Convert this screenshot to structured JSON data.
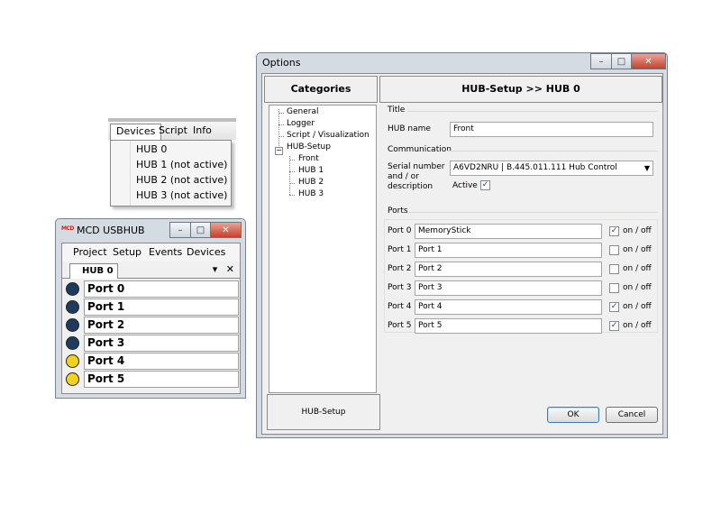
{
  "devices_menu": {
    "menubar": [
      "Devices",
      "Script",
      "Info"
    ],
    "items": [
      "HUB 0",
      "HUB 1 (not active)",
      "HUB 2 (not active)",
      "HUB 3 (not active)"
    ]
  },
  "usbhub_window": {
    "logo": "MCD",
    "title": "MCD USBHUB",
    "menu": [
      "Project",
      "Setup",
      "Events",
      "Devices"
    ],
    "tab": "HUB 0",
    "tab_tools": {
      "dropdown": "▾",
      "close": "✕"
    },
    "ports": [
      {
        "label": "Port 0",
        "state": "inactive"
      },
      {
        "label": "Port 1",
        "state": "inactive"
      },
      {
        "label": "Port 2",
        "state": "inactive"
      },
      {
        "label": "Port 3",
        "state": "inactive"
      },
      {
        "label": "Port 4",
        "state": "active"
      },
      {
        "label": "Port 5",
        "state": "active"
      }
    ]
  },
  "options_dialog": {
    "title": "Options",
    "categories_header": "Categories",
    "content_header": "HUB-Setup >> HUB 0",
    "tree": [
      "General",
      "Logger",
      "Script / Visualization",
      "HUB-Setup",
      "Front",
      "HUB 1",
      "HUB 2",
      "HUB 3"
    ],
    "tree_expander": "−",
    "bottom_label": "HUB-Setup",
    "title_group": {
      "label": "Title",
      "hub_name_label": "HUB name",
      "hub_name_value": "Front"
    },
    "communication_group": {
      "label": "Communication",
      "serial_label_lines": [
        "Serial number",
        "and / or",
        "description"
      ],
      "serial_value": "A6VD2NRU | B.445.011.111 Hub Control",
      "active_label": "Active",
      "active_checked": true
    },
    "ports_group": {
      "label": "Ports",
      "onoff_label": "on / off",
      "ports": [
        {
          "label": "Port 0",
          "name": "MemoryStick",
          "on": true
        },
        {
          "label": "Port 1",
          "name": "Port 1",
          "on": false
        },
        {
          "label": "Port 2",
          "name": "Port 2",
          "on": false
        },
        {
          "label": "Port 3",
          "name": "Port 3",
          "on": false
        },
        {
          "label": "Port 4",
          "name": "Port 4",
          "on": true
        },
        {
          "label": "Port 5",
          "name": "Port 5",
          "on": true
        }
      ]
    },
    "ok_label": "OK",
    "cancel_label": "Cancel"
  },
  "window_controls": {
    "minimize": "–",
    "maximize": "□",
    "close": "✕"
  },
  "colors": {
    "port_inactive": "#1e3a5c",
    "port_active": "#f2d21c",
    "check": "#1c3f7a"
  },
  "check_mark": "✓"
}
